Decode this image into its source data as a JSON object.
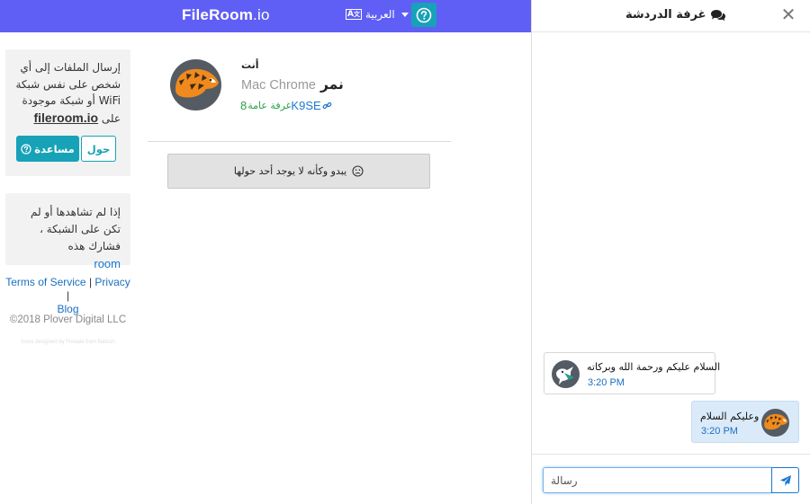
{
  "topbar": {
    "brand_bold": "FileRoom",
    "brand_suffix": ".io",
    "language_label": "العربية",
    "language_glyph": "A",
    "help_icon": "question-circle-icon",
    "bg_color": "#5f5ff5"
  },
  "sidebar": {
    "intro_text": "إرسال الملفات إلى أي شخص على نفس شبكة WiFi أو شبكة موجودة على",
    "intro_link": "fileroom.io",
    "help_button": "مساعدة",
    "about_button": "حول",
    "share_text": "إذا لم تشاهدها أو لم تكن على الشبكة ، فشارك هذه",
    "share_link": "room",
    "links": {
      "terms": "Terms of Service",
      "privacy": "Privacy",
      "blog": "Blog",
      "sep": "|"
    },
    "copyright": "©2018 Plover Digital LLC",
    "credit": "Icons designed by Freepik from flaticon"
  },
  "profile": {
    "you_label": "أنت",
    "name": "نمر",
    "device": "Mac Chrome",
    "room_count": "8",
    "room_public": "غرفة عامة",
    "room_code": "K9SE",
    "empty_message": "يبدو وكأنه لا يوجد أحد حولها"
  },
  "chat": {
    "title": "غرفة الدردشة",
    "close_icon": "close-icon",
    "messages": [
      {
        "text": "السلام عليكم ورحمة الله وبركاته",
        "time": "3:20 PM",
        "sender": "other"
      },
      {
        "text": "وعليكم السلام",
        "time": "3:20 PM",
        "sender": "self"
      }
    ],
    "input_value": "رسالة",
    "send_icon": "paper-plane-icon"
  }
}
